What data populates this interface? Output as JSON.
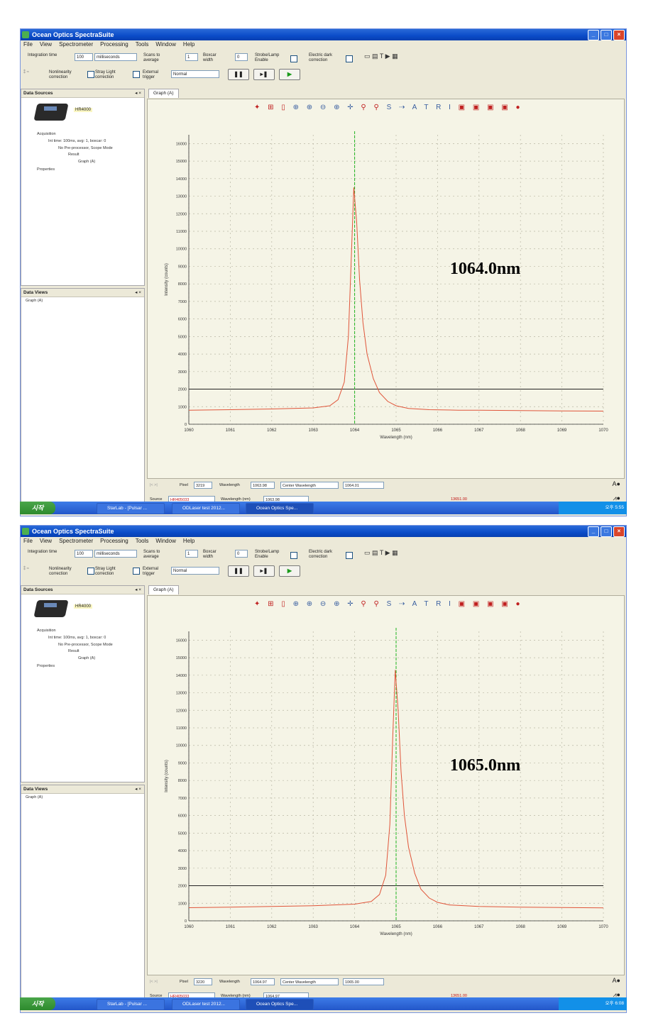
{
  "panels": [
    {
      "window": {
        "title": "Ocean Optics SpectraSuite",
        "menu": [
          "File",
          "View",
          "Spectrometer",
          "Processing",
          "Tools",
          "Window",
          "Help"
        ]
      },
      "toolbar": {
        "integration_time_label": "Integration time",
        "integration_time_value": "100",
        "integration_units": "milliseconds",
        "scans_label": "Scans to average",
        "scans_value": "1",
        "boxcar_label": "Boxcar width",
        "boxcar_value": "0",
        "strobe_label": "Strobe/Lamp Enable",
        "dark_label": "Electric dark correction",
        "nonlinearity_label": "Nonlinearity correction",
        "stray_label": "Stray Light correction",
        "trigger_label": "External trigger",
        "trigger_mode": "Normal"
      },
      "data_sources": {
        "header": "Data Sources",
        "device": "HR4000",
        "tree": [
          "Acquisition",
          "Int time: 100ms, avg: 1, boxcar: 0",
          "No Pre-processor, Scope Mode",
          "Result",
          "Graph (A)",
          "Properties"
        ]
      },
      "data_views": {
        "header": "Data Views",
        "tree": [
          "Graph (A)"
        ]
      },
      "tab_label": "Graph (A)",
      "annotation": "1064.0nm",
      "readout": {
        "pixel_label": "Pixel",
        "pixel_value": "3219",
        "wavelength_label": "Wavelength",
        "wavelength_value": "1063.98",
        "mode_select": "Center Wavelength",
        "center_value": "1064.01",
        "source_label": "Source",
        "source_value": "HR405033",
        "wavelength_nm_label": "Wavelength (nm)",
        "wavelength_nm_value": "1063.98",
        "intensity_value": "13651.00"
      },
      "taskbar": {
        "start_label": "시작",
        "tasks": [
          "StarLab - [Pulsar ...",
          "ODLaser test 2012...",
          "Ocean Optics Spe..."
        ],
        "clock": "오후 5:55"
      },
      "chart_data": {
        "type": "line",
        "xlabel": "Wavelength (nm)",
        "ylabel": "Intensity (counts)",
        "xlim": [
          1060,
          1070
        ],
        "ylim": [
          0,
          16500
        ],
        "x_ticks": [
          "1060",
          "1061",
          "1062",
          "1063",
          "1064",
          "1065",
          "1066",
          "1067",
          "1068",
          "1069",
          "1070"
        ],
        "y_ticks": [
          "0",
          "1000",
          "2000",
          "3000",
          "4000",
          "5000",
          "6000",
          "7000",
          "8000",
          "9000",
          "10000",
          "11000",
          "12000",
          "13000",
          "14000",
          "15000",
          "16000"
        ],
        "grid": true,
        "series": [
          {
            "x": [
              1060,
              1061,
              1062,
              1063,
              1063.4,
              1063.6,
              1063.75,
              1063.85,
              1063.92,
              1063.98,
              1064.05,
              1064.12,
              1064.2,
              1064.3,
              1064.45,
              1064.6,
              1064.8,
              1065.0,
              1065.3,
              1065.8,
              1066.5,
              1067,
              1068,
              1069,
              1070
            ],
            "y": [
              800,
              830,
              870,
              930,
              1050,
              1400,
              2400,
              5000,
              9500,
              13500,
              11500,
              8200,
              5800,
              4000,
              2600,
              1800,
              1300,
              1050,
              900,
              830,
              800,
              800,
              780,
              760,
              750
            ]
          }
        ],
        "marker_x": 1064.0,
        "threshold_y": 2000
      }
    },
    {
      "window": {
        "title": "Ocean Optics SpectraSuite",
        "menu": [
          "File",
          "View",
          "Spectrometer",
          "Processing",
          "Tools",
          "Window",
          "Help"
        ]
      },
      "toolbar": {
        "integration_time_label": "Integration time",
        "integration_time_value": "100",
        "integration_units": "milliseconds",
        "scans_label": "Scans to average",
        "scans_value": "1",
        "boxcar_label": "Boxcar width",
        "boxcar_value": "0",
        "strobe_label": "Strobe/Lamp Enable",
        "dark_label": "Electric dark correction",
        "nonlinearity_label": "Nonlinearity correction",
        "stray_label": "Stray Light correction",
        "trigger_label": "External trigger",
        "trigger_mode": "Normal"
      },
      "data_sources": {
        "header": "Data Sources",
        "device": "HR4000",
        "tree": [
          "Acquisition",
          "Int time: 100ms, avg: 1, boxcar: 0",
          "No Pre-processor, Scope Mode",
          "Result",
          "Graph (A)",
          "Properties"
        ]
      },
      "data_views": {
        "header": "Data Views",
        "tree": [
          "Graph (A)"
        ]
      },
      "tab_label": "Graph (A)",
      "annotation": "1065.0nm",
      "readout": {
        "pixel_label": "Pixel",
        "pixel_value": "3220",
        "wavelength_label": "Wavelength",
        "wavelength_value": "1064.97",
        "mode_select": "Center Wavelength",
        "center_value": "1065.00",
        "source_label": "Source",
        "source_value": "HR405033",
        "wavelength_nm_label": "Wavelength (nm)",
        "wavelength_nm_value": "1064.97",
        "intensity_value": "13651.00"
      },
      "taskbar": {
        "start_label": "시작",
        "tasks": [
          "StarLab - [Pulsar ...",
          "ODLaser test 2012...",
          "Ocean Optics Spe..."
        ],
        "clock": "오후 6:08"
      },
      "chart_data": {
        "type": "line",
        "xlabel": "Wavelength (nm)",
        "ylabel": "Intensity (counts)",
        "xlim": [
          1060,
          1070
        ],
        "ylim": [
          0,
          16500
        ],
        "x_ticks": [
          "1060",
          "1061",
          "1062",
          "1063",
          "1064",
          "1065",
          "1066",
          "1067",
          "1068",
          "1069",
          "1070"
        ],
        "y_ticks": [
          "0",
          "1000",
          "2000",
          "3000",
          "4000",
          "5000",
          "6000",
          "7000",
          "8000",
          "9000",
          "10000",
          "11000",
          "12000",
          "13000",
          "14000",
          "15000",
          "16000"
        ],
        "grid": true,
        "series": [
          {
            "x": [
              1060,
              1061,
              1062,
              1063,
              1064,
              1064.4,
              1064.6,
              1064.75,
              1064.85,
              1064.92,
              1064.98,
              1065.05,
              1065.12,
              1065.2,
              1065.3,
              1065.45,
              1065.6,
              1065.8,
              1066.0,
              1066.3,
              1067,
              1068,
              1069,
              1070
            ],
            "y": [
              750,
              780,
              820,
              860,
              950,
              1100,
              1500,
              2600,
              5500,
              10500,
              14300,
              12000,
              8500,
              6000,
              4200,
              2700,
              1800,
              1300,
              1050,
              900,
              820,
              780,
              760,
              740
            ]
          }
        ],
        "marker_x": 1065.0,
        "threshold_y": 2000
      }
    }
  ],
  "colors": {
    "spectrum": "#e0553a",
    "marker": "#1db31d",
    "threshold": "#222222",
    "grid": "#b9b7a4",
    "plot_bg": "#f5f4e6"
  }
}
